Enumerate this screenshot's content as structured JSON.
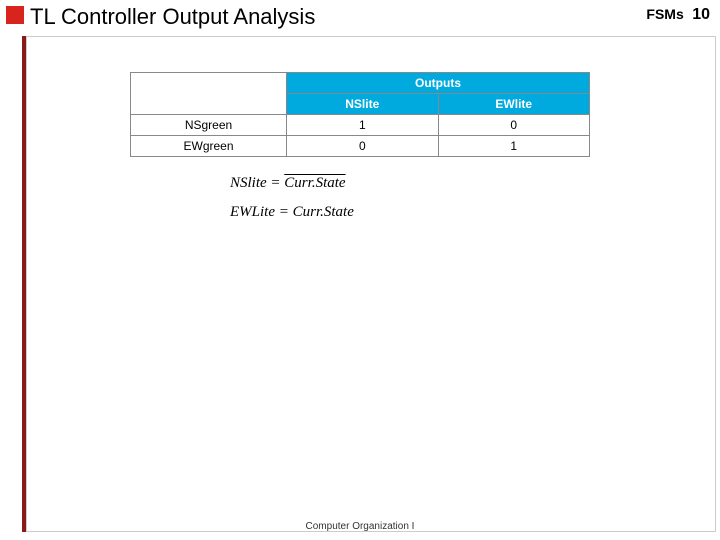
{
  "header": {
    "title": "TL Controller Output Analysis",
    "section_label": "FSMs",
    "page_number": "10"
  },
  "table": {
    "outputs_header": "Outputs",
    "col1": "NSlite",
    "col2": "EWlite",
    "rows": [
      {
        "label": "NSgreen",
        "ns": "1",
        "ew": "0"
      },
      {
        "label": "EWgreen",
        "ns": "0",
        "ew": "1"
      }
    ]
  },
  "equations": {
    "eq1_lhs": "NSlite",
    "eq1_eq": " = ",
    "eq1_rhs": "Curr.State",
    "eq2_lhs": "EWLite",
    "eq2_eq": " = ",
    "eq2_rhs": "Curr.State"
  },
  "footer": {
    "text": "Computer Organization I"
  }
}
